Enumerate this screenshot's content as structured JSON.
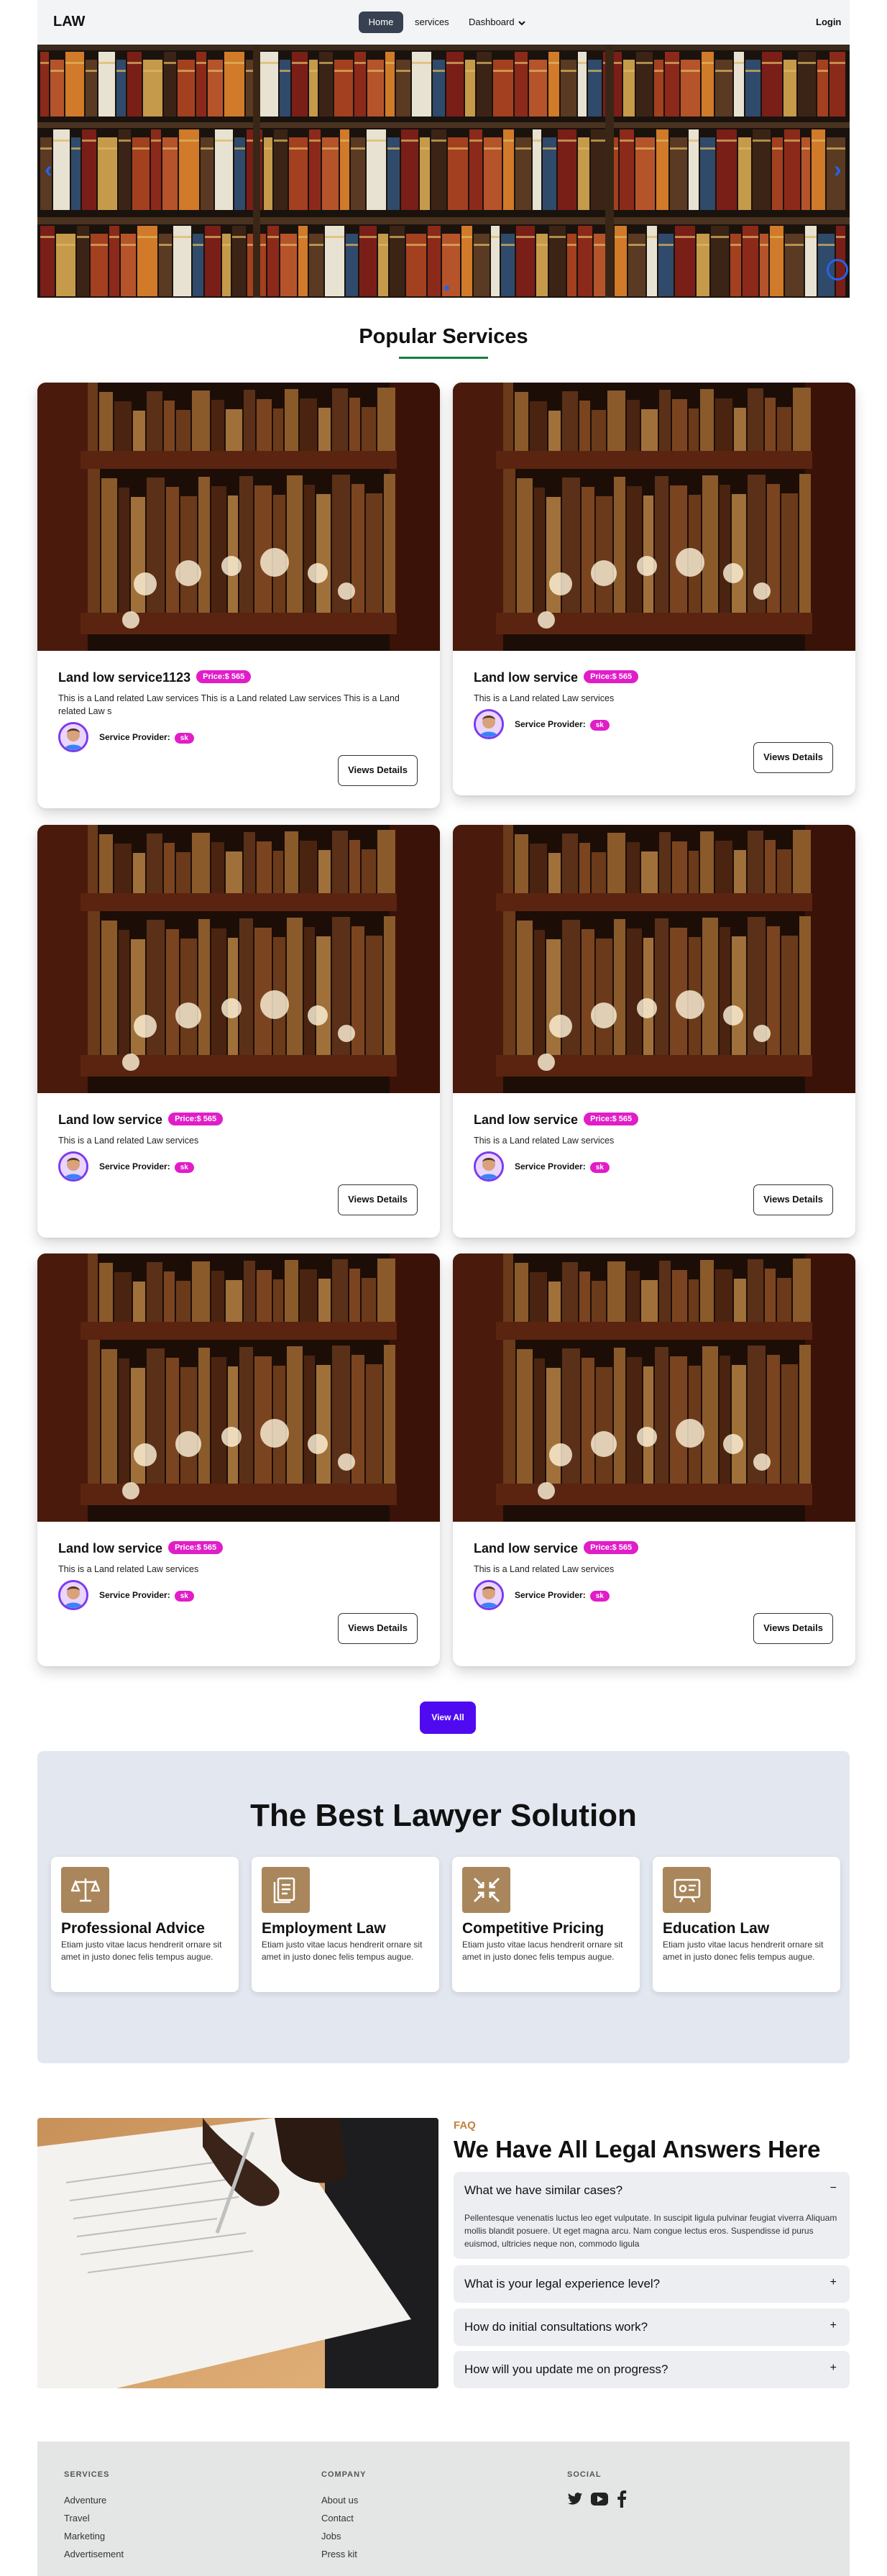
{
  "nav": {
    "brand": "LAW",
    "home": "Home",
    "services": "services",
    "dashboard": "Dashboard",
    "login": "Login"
  },
  "hero": {
    "prev_icon": "chevron-left-icon",
    "next_icon": "chevron-right-icon"
  },
  "popular": {
    "title": "Popular Services",
    "services": [
      {
        "title": "Land low service1123",
        "price": "Price:$ 565",
        "description": "This is a Land related Law services This is a Land related Law services This is a Land related Law s",
        "provider_label": "Service Provider:",
        "provider": "sk",
        "button": "Views Details"
      },
      {
        "title": "Land low service",
        "price": "Price:$ 565",
        "description": "This is a Land related Law services",
        "provider_label": "Service Provider:",
        "provider": "sk",
        "button": "Views Details"
      },
      {
        "title": "Land low service",
        "price": "Price:$ 565",
        "description": "This is a Land related Law services",
        "provider_label": "Service Provider:",
        "provider": "sk",
        "button": "Views Details"
      },
      {
        "title": "Land low service",
        "price": "Price:$ 565",
        "description": "This is a Land related Law services",
        "provider_label": "Service Provider:",
        "provider": "sk",
        "button": "Views Details"
      },
      {
        "title": "Land low service",
        "price": "Price:$ 565",
        "description": "This is a Land related Law services",
        "provider_label": "Service Provider:",
        "provider": "sk",
        "button": "Views Details"
      },
      {
        "title": "Land low service",
        "price": "Price:$ 565",
        "description": "This is a Land related Law services",
        "provider_label": "Service Provider:",
        "provider": "sk",
        "button": "Views Details"
      }
    ],
    "view_all": "View All"
  },
  "solution": {
    "title": "The Best Lawyer Solution",
    "items": [
      {
        "icon": "scales-icon",
        "title": "Professional Advice",
        "text": "Etiam justo vitae lacus hendrerit ornare sit amet in justo donec felis tempus augue."
      },
      {
        "icon": "document-icon",
        "title": "Employment Law",
        "text": "Etiam justo vitae lacus hendrerit ornare sit amet in justo donec felis tempus augue."
      },
      {
        "icon": "compress-arrows-icon",
        "title": "Competitive Pricing",
        "text": "Etiam justo vitae lacus hendrerit ornare sit amet in justo donec felis tempus augue."
      },
      {
        "icon": "presentation-icon",
        "title": "Education Law",
        "text": "Etiam justo vitae lacus hendrerit ornare sit amet in justo donec felis tempus augue."
      }
    ]
  },
  "faq": {
    "label": "FAQ",
    "title": "We Have All Legal Answers Here",
    "items": [
      {
        "q": "What we have similar cases?",
        "sign": "−",
        "a": "Pellentesque venenatis luctus leo eget vulputate. In suscipit ligula pulvinar feugiat viverra Aliquam mollis blandit posuere. Ut eget magna arcu. Nam congue lectus eros. Suspendisse id purus euismod, ultricies neque non, commodo ligula"
      },
      {
        "q": "What is your legal experience level?",
        "sign": "+"
      },
      {
        "q": "How do initial consultations work?",
        "sign": "+"
      },
      {
        "q": "How will you update me on progress?",
        "sign": "+"
      }
    ]
  },
  "footer": {
    "services_head": "SERVICES",
    "services": [
      "Adventure",
      "Travel",
      "Marketing",
      "Advertisement"
    ],
    "company_head": "COMPANY",
    "company": [
      "About us",
      "Contact",
      "Jobs",
      "Press kit"
    ],
    "social_head": "SOCIAL",
    "social_icons": [
      "twitter-icon",
      "youtube-icon",
      "facebook-icon"
    ]
  },
  "colors": {
    "accent": "#4f0af0",
    "badge": "#e11dc8",
    "underline": "#15803d",
    "solution_bg": "#e2e7f0",
    "icon_bg": "#a9865b",
    "faq_label": "#c4813d"
  }
}
